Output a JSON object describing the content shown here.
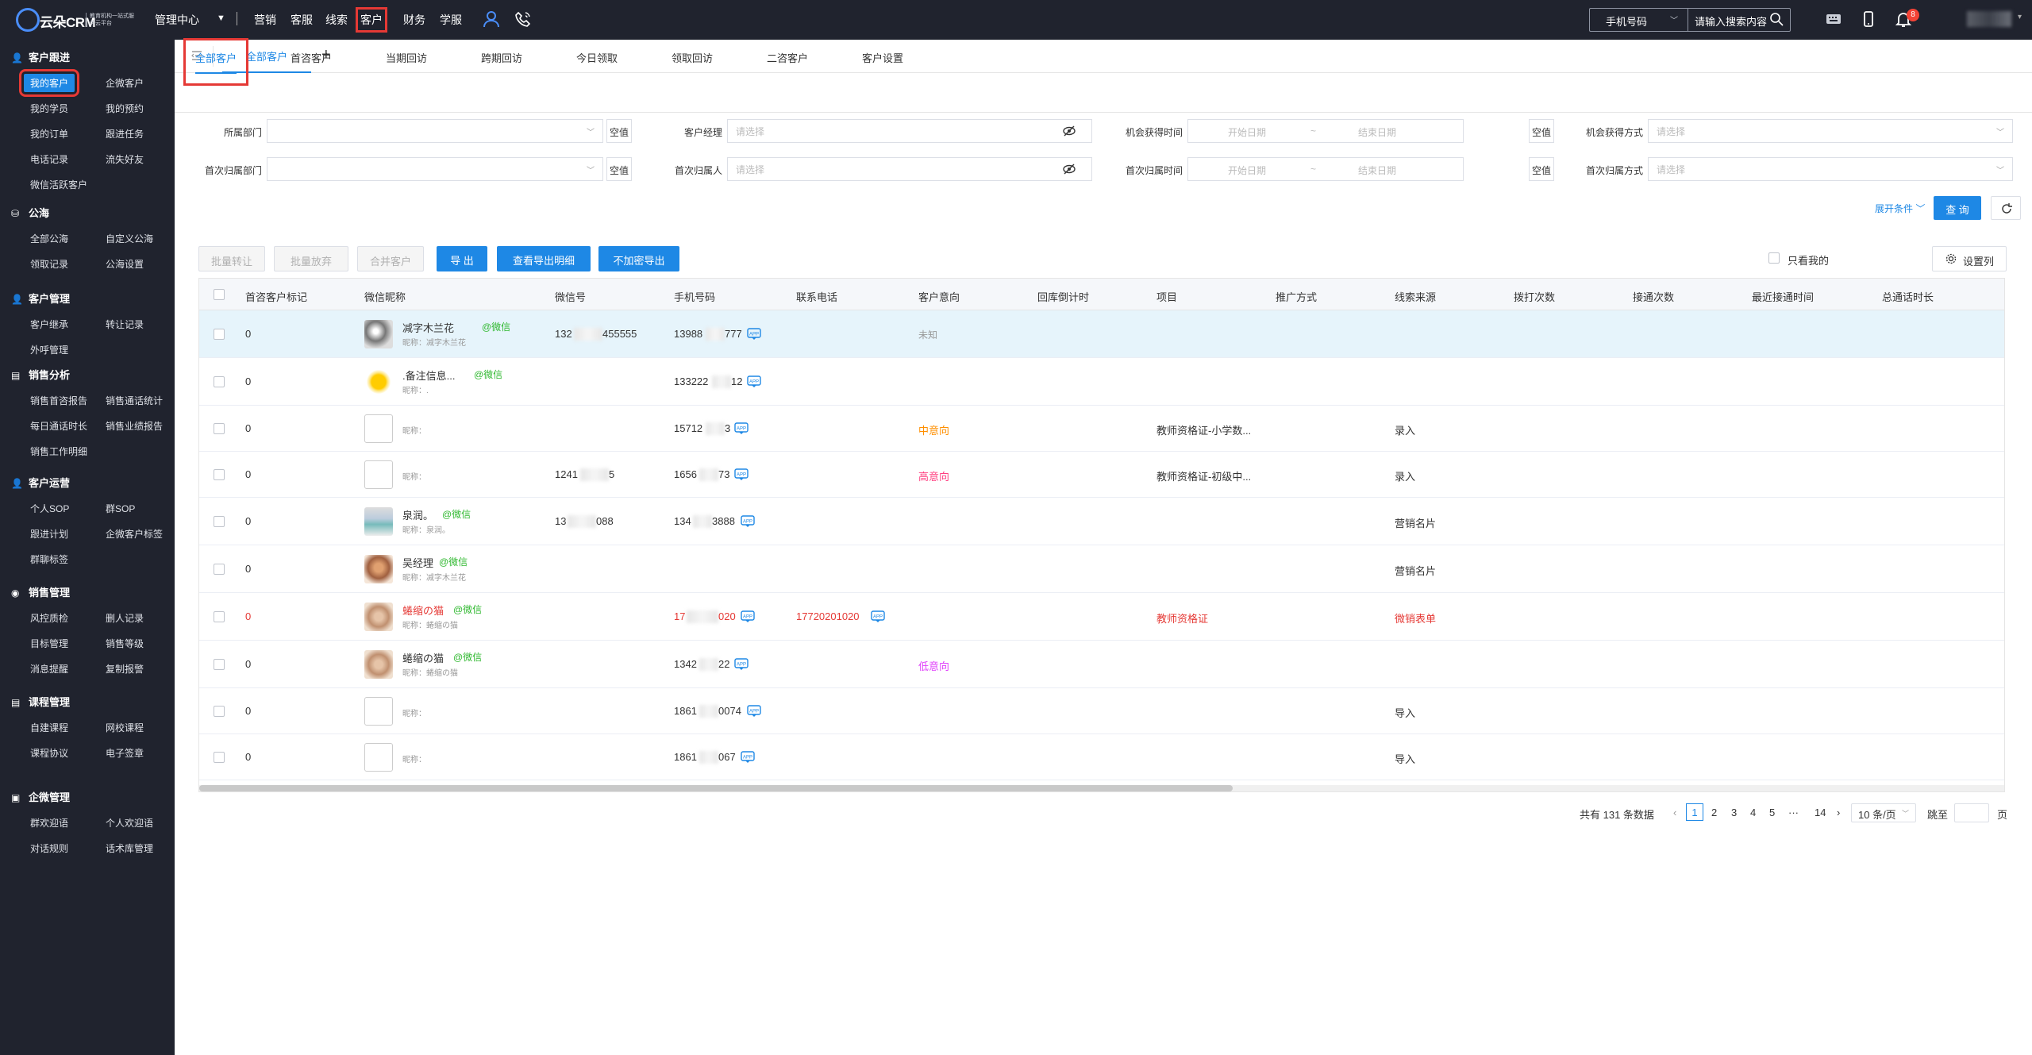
{
  "app": {
    "logo_text": "云朵CRM",
    "logo_sub": "教育机构一站式服务云平台",
    "mgmt_center": "管理中心",
    "nav": [
      "营销",
      "客服",
      "线索",
      "客户",
      "财务",
      "学服"
    ],
    "active_nav": "客户"
  },
  "search": {
    "type": "手机号码",
    "placeholder": "请输入搜索内容"
  },
  "notifications": {
    "count": "8"
  },
  "sidebar": {
    "groups": [
      {
        "title": "客户跟进",
        "icon": "user-plus-icon",
        "items": [
          "我的客户",
          "企微客户",
          "我的学员",
          "我的预约",
          "我的订单",
          "跟进任务",
          "电话记录",
          "流失好友",
          "微信活跃客户"
        ]
      },
      {
        "title": "公海",
        "icon": "sea-icon",
        "items": [
          "全部公海",
          "自定义公海",
          "领取记录",
          "公海设置"
        ]
      },
      {
        "title": "客户管理",
        "icon": "user-icon",
        "items": [
          "客户继承",
          "转让记录",
          "外呼管理"
        ]
      },
      {
        "title": "销售分析",
        "icon": "chart-icon",
        "items": [
          "销售首咨报告",
          "销售通话统计",
          "每日通话时长",
          "销售业绩报告",
          "销售工作明细"
        ]
      },
      {
        "title": "客户运营",
        "icon": "user-icon",
        "items": [
          "个人SOP",
          "群SOP",
          "跟进计划",
          "企微客户标签",
          "群聊标签"
        ]
      },
      {
        "title": "销售管理",
        "icon": "target-icon",
        "items": [
          "风控质检",
          "删人记录",
          "目标管理",
          "销售等级",
          "消息提醒",
          "复制报警"
        ]
      },
      {
        "title": "课程管理",
        "icon": "book-icon",
        "items": [
          "自建课程",
          "网校课程",
          "课程协议",
          "电子签章"
        ]
      },
      {
        "title": "企微管理",
        "icon": "folder-icon",
        "items": [
          "群欢迎语",
          "个人欢迎语",
          "对话规则",
          "话术库管理"
        ]
      }
    ]
  },
  "tabs": {
    "active": "全部客户",
    "add": "+"
  },
  "subtabs": [
    "全部客户",
    "首咨客户",
    "当期回访",
    "跨期回访",
    "今日领取",
    "领取回访",
    "二咨客户",
    "客户设置"
  ],
  "filters": {
    "dept": "所属部门",
    "manager": "客户经理",
    "opp_time": "机会获得时间",
    "opp_method": "机会获得方式",
    "first_dept": "首次归属部门",
    "first_owner": "首次归属人",
    "first_time": "首次归属时间",
    "first_method": "首次归属方式",
    "empty": "空值",
    "please_select": "请选择",
    "start_date": "开始日期",
    "end_date": "结束日期",
    "tilde": "~",
    "expand": "展开条件",
    "query": "查 询"
  },
  "actions": {
    "batch_transfer": "批量转让",
    "batch_release": "批量放弃",
    "merge": "合并客户",
    "export": "导 出",
    "export_detail": "查看导出明细",
    "export_plain": "不加密导出",
    "only_mine": "只看我的",
    "set_columns": "设置列"
  },
  "table": {
    "columns": [
      "首咨客户标记",
      "微信昵称",
      "微信号",
      "手机号码",
      "联系电话",
      "客户意向",
      "回库倒计时",
      "项目",
      "推广方式",
      "线索来源",
      "拨打次数",
      "接通次数",
      "最近接通时间",
      "总通话时长"
    ],
    "rows": [
      {
        "mark": "0",
        "nick": "减字木兰花",
        "wx": "@微信",
        "remark": "昵称：减字木兰花",
        "wechat_id": "132",
        "wechat_tail": "455555",
        "phone": "13988",
        "phone_tail": "777",
        "tel": "",
        "intent": "未知",
        "project": "",
        "source": "",
        "red": false,
        "highlight": true
      },
      {
        "mark": "0",
        "nick": ".备注信息...",
        "wx": "@微信",
        "remark": "昵称：.",
        "wechat_id": "",
        "wechat_tail": "",
        "phone": "133222",
        "phone_tail": "12",
        "tel": "",
        "intent": "",
        "project": "",
        "source": "",
        "red": false,
        "highlight": false
      },
      {
        "mark": "0",
        "nick": "",
        "wx": "",
        "remark": "昵称：",
        "wechat_id": "",
        "wechat_tail": "",
        "phone": "15712",
        "phone_tail": "3",
        "tel": "",
        "intent": "中意向",
        "project": "教师资格证-小学数...",
        "source": "录入",
        "red": false,
        "highlight": false
      },
      {
        "mark": "0",
        "nick": "",
        "wx": "",
        "remark": "昵称：",
        "wechat_id": "1241",
        "wechat_tail": "5",
        "phone": "1656",
        "phone_tail": "73",
        "tel": "",
        "intent": "高意向",
        "project": "教师资格证-初级中...",
        "source": "录入",
        "red": false,
        "highlight": false
      },
      {
        "mark": "0",
        "nick": "泉润。",
        "wx": "@微信",
        "remark": "昵称：泉润。",
        "wechat_id": "13",
        "wechat_tail": "088",
        "phone": "134",
        "phone_tail": "3888",
        "tel": "",
        "intent": "",
        "project": "",
        "source": "营销名片",
        "red": false,
        "highlight": false
      },
      {
        "mark": "0",
        "nick": "吴经理",
        "wx": "@微信",
        "remark": "昵称：减字木兰花",
        "wechat_id": "",
        "wechat_tail": "",
        "phone": "",
        "phone_tail": "",
        "tel": "",
        "intent": "",
        "project": "",
        "source": "营销名片",
        "red": false,
        "highlight": false
      },
      {
        "mark": "0",
        "nick": "蜷缩の猫",
        "wx": "@微信",
        "remark": "昵称：蜷缩の猫",
        "wechat_id": "",
        "wechat_tail": "",
        "phone": "17",
        "phone_tail": "020",
        "tel": "17720201020",
        "intent": "",
        "project": "教师资格证",
        "source": "微销表单",
        "red": true,
        "highlight": false
      },
      {
        "mark": "0",
        "nick": "蜷缩の猫",
        "wx": "@微信",
        "remark": "昵称：蜷缩の猫",
        "wechat_id": "",
        "wechat_tail": "",
        "phone": "1342",
        "phone_tail": "22",
        "tel": "",
        "intent": "低意向",
        "project": "",
        "source": "",
        "red": false,
        "highlight": false
      },
      {
        "mark": "0",
        "nick": "",
        "wx": "",
        "remark": "昵称：",
        "wechat_id": "",
        "wechat_tail": "",
        "phone": "1861",
        "phone_tail": "0074",
        "tel": "",
        "intent": "",
        "project": "",
        "source": "导入",
        "red": false,
        "highlight": false
      },
      {
        "mark": "0",
        "nick": "",
        "wx": "",
        "remark": "昵称：",
        "wechat_id": "",
        "wechat_tail": "",
        "phone": "1861",
        "phone_tail": "067",
        "tel": "",
        "intent": "",
        "project": "",
        "source": "导入",
        "red": false,
        "highlight": false
      }
    ]
  },
  "pagination": {
    "total": "共有 131 条数据",
    "pages": [
      "1",
      "2",
      "3",
      "4",
      "5",
      "···",
      "14"
    ],
    "current": "1",
    "page_size": "10 条/页",
    "jump": "跳至",
    "page_unit": "页"
  }
}
